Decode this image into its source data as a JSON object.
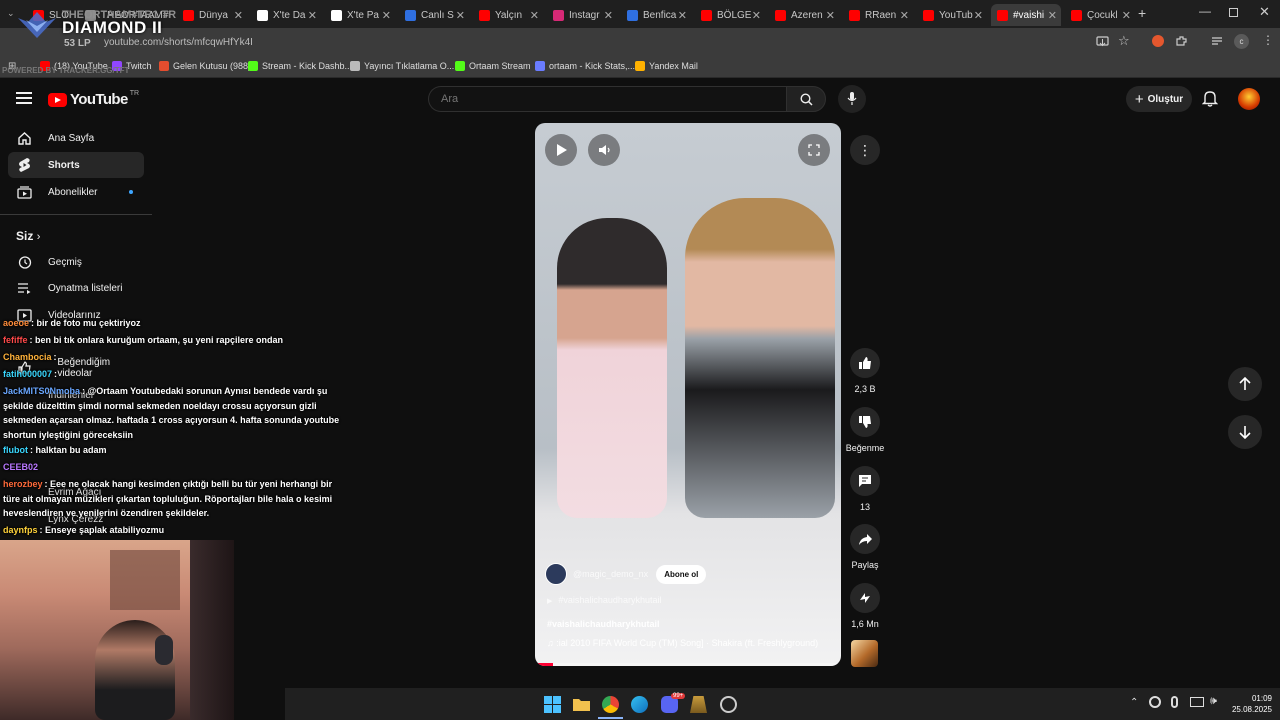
{
  "browser": {
    "tabs": [
      {
        "label": "SLO",
        "icon": "youtube-icon",
        "color": "#ff0000"
      },
      {
        "label": "THEORTAAM#TR1 TR",
        "icon": "tab-icon",
        "color": "#8a8a8a"
      },
      {
        "label": "Dünya",
        "icon": "youtube-icon",
        "color": "#ff0000"
      },
      {
        "label": "X'te Da",
        "icon": "x-icon",
        "color": "#ffffff"
      },
      {
        "label": "X'te Pa",
        "icon": "x-icon",
        "color": "#ffffff"
      },
      {
        "label": "Canlı S",
        "icon": "m-icon",
        "color": "#2f6fe0"
      },
      {
        "label": "Yalçın",
        "icon": "youtube-icon",
        "color": "#ff0000"
      },
      {
        "label": "Instagr",
        "icon": "instagram-icon",
        "color": "#d62976"
      },
      {
        "label": "Benfica",
        "icon": "m-icon",
        "color": "#2f6fe0"
      },
      {
        "label": "BÖLGE",
        "icon": "youtube-icon",
        "color": "#ff0000"
      },
      {
        "label": "Azeren",
        "icon": "youtube-icon",
        "color": "#ff0000"
      },
      {
        "label": "RRaen",
        "icon": "youtube-icon",
        "color": "#ff0000"
      },
      {
        "label": "YouTub",
        "icon": "youtube-icon",
        "color": "#ff0000"
      },
      {
        "label": "#vaishi",
        "icon": "youtube-icon",
        "color": "#ff0000",
        "active": true
      },
      {
        "label": "Çocukl",
        "icon": "youtube-icon",
        "color": "#ff0000"
      }
    ],
    "new_tab": "+",
    "url": "youtube.com/shorts/mfcqwHfYk4I",
    "bookmarks": [
      {
        "label": "(18) YouTube",
        "color": "#ff0000"
      },
      {
        "label": "Twitch",
        "color": "#9146ff"
      },
      {
        "label": "Gelen Kutusu (988)...",
        "color": "#e44d2e"
      },
      {
        "label": "Stream - Kick Dashb...",
        "color": "#53fc18"
      },
      {
        "label": "Yayıncı Tıklatlama O...",
        "color": "#bbbbbb"
      },
      {
        "label": "Ortaam Stream",
        "color": "#53fc18"
      },
      {
        "label": "ortaam - Kick Stats,...",
        "color": "#6a7cff"
      },
      {
        "label": "Yandex Mail",
        "color": "#ffb200"
      }
    ]
  },
  "stream_overlay": {
    "rank": "DIAMOND II",
    "lp": "53 LP",
    "name": "THEORTAAM#TR1 TR",
    "powered": "POWERED BY TRACKER.GG/TFT"
  },
  "youtube": {
    "logo_text": "YouTube",
    "region": "TR",
    "search_placeholder": "Ara",
    "create_label": "Oluştur",
    "sidebar": {
      "items": [
        {
          "label": "Ana Sayfa",
          "icon": "home-icon"
        },
        {
          "label": "Shorts",
          "icon": "shorts-icon",
          "active": true
        },
        {
          "label": "Abonelikler",
          "icon": "subscriptions-icon"
        }
      ],
      "you_section": "Siz",
      "you_items": [
        {
          "label": "Geçmiş",
          "icon": "history-icon"
        },
        {
          "label": "Oynatma listeleri",
          "icon": "playlists-icon"
        },
        {
          "label": "Videolarınız",
          "icon": "your-videos-icon"
        },
        {
          "label": "Beğendiğim videolar",
          "icon": "liked-videos-icon"
        }
      ],
      "partial_items": [
        "İndirilenler",
        "Evrim Ağacı",
        "Lynx Çerezz"
      ]
    },
    "short": {
      "channel": "@magic_demo_nx",
      "subscribe": "Abone ol",
      "hashtag_link": "#vaishalichaudharykhutail",
      "title": "#vaishalichaudharykhutail",
      "music": "♫ :ial 2010 FIFA World Cup (TM) Song] · Shakira (ft. Freshlyground)",
      "progress": 0.06
    },
    "actions": {
      "likes": "2,3 B",
      "dislike_label": "Beğenme",
      "comments": "13",
      "share_label": "Paylaş",
      "remix_count": "1,6 Mn"
    }
  },
  "chat": [
    {
      "user": "aoeoe",
      "color": "#ff8c3a",
      "text": ": bir de foto mu çektiriyoz"
    },
    {
      "user": "fefiffe",
      "color": "#ff4a4a",
      "text": ": ben bi tık onlara kuruğum ortaam, şu yeni rapçilere ondan"
    },
    {
      "user": "Chambocia",
      "color": "#ffb23a",
      "text": ":"
    },
    {
      "user": "fatih000007",
      "color": "#3ad8ff",
      "text": ":"
    },
    {
      "user": "JackMITS0Nmoba",
      "color": "#6aa7ff",
      "text": ": @Ortaam Youtubedaki sorunun Aynısı bendede vardı şu şekilde düzelttim şimdi normal sekmeden noeldayı crossu açıyorsun gizli sekmeden açarsan olmaz. haftada 1 cross açıyorsun 4. hafta sonunda youtube shortun iyleştiğini göreceksiin"
    },
    {
      "user": "flubot",
      "color": "#3ad8ff",
      "text": ": halktan bu adam"
    },
    {
      "user": "CEEB02",
      "color": "#b978ff",
      "text": ""
    },
    {
      "user": "herozbey",
      "color": "#ff6a3a",
      "text": ": Eee ne olacak hangi kesimden çıktığı belli bu tür yeni herhangi bir türe ait olmayan müzikleri çıkartan topluluğun. Röportajları bile hala o kesimi heveslendiren ve yenilerini özendiren şekildeler."
    },
    {
      "user": "daynfps",
      "color": "#ffd23a",
      "text": ": Enseye şaplak atabiliyozmu"
    }
  ],
  "taskbar": {
    "time": "01:09",
    "date": "25.08.2025",
    "badge": "99+"
  }
}
